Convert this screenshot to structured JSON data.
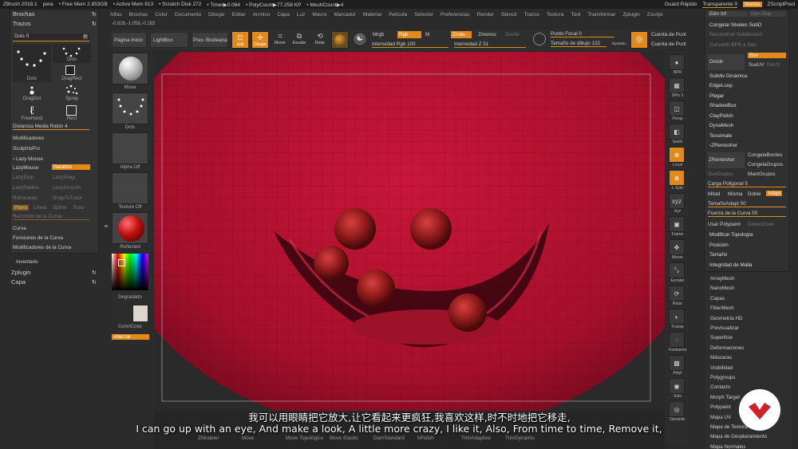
{
  "titlebar": {
    "app": "ZBrush 2018.1",
    "doc": "pera",
    "stats": [
      "• Free Mem 2.853GB",
      "• Active Mem 813",
      "• Scratch Disk 272",
      "• Timer▶0.064",
      "• PolyCount▶77.258 KP",
      "• MeshCount▶4"
    ],
    "quicksave": "Guard Rápido",
    "transparent": "Transparente 0",
    "menus_btn": "Menús",
    "script": "ZScriptPred"
  },
  "menubar": [
    "Alfas",
    "Brochas",
    "Color",
    "Documento",
    "Dibujar",
    "Editar",
    "Archivo",
    "Capa",
    "Luz",
    "Macro",
    "Marcador",
    "Material",
    "Película",
    "Selector",
    "Preferencias",
    "Render",
    "Stencil",
    "Trazos",
    "Textura",
    "Tool",
    "Transformar",
    "Zplugin",
    "Zscript"
  ],
  "coords": "-0.826,-1.058,-0.183",
  "toolbar": {
    "home": "Página Inicio",
    "lightbox": "LightBox",
    "preview": "Prev. Booleana",
    "edit": "Edit",
    "draw": "Dibujar",
    "move": "Mover",
    "scale": "Escalar",
    "rotate": "Rotar",
    "mrgb": "Mrgb",
    "rgb": "Rgb",
    "m": "M",
    "zadd": "Zmás",
    "zsub": "Zmenos",
    "zcut": "Zcorte",
    "rgb_intensity": "Intensidad Rgb 100",
    "z_intensity": "Intensidad Z 51",
    "focal": "Punto Focal 0",
    "draw_size": "Tamaño de dibujo 132",
    "dynamic": "Dynamic",
    "cuenta1": "Cuenta de Punt",
    "cuenta2": "Cuenta de Punt"
  },
  "left_panel": {
    "brushes_header": "Brochas",
    "strokes_header": "Trazos",
    "dots": "Dots 0",
    "r": "R",
    "stroke_types": [
      "Dots",
      "Dots",
      "DragDot",
      "DragRect",
      "FreeHand",
      "Spray",
      "Rect"
    ],
    "mouse_avg": "Distancia Media Ratón 4",
    "modifiers": "Modificadores",
    "sculptris": "SculptrisPro",
    "lazy_mouse": "Lazy Mouse",
    "lazymouse": "LazyMouse",
    "relative": "Relativo",
    "lazystep": "LazyStep",
    "lazysnap": "LazySnap",
    "lazyradius": "LazyRadius",
    "lazysmooth": "LazySmooth",
    "backtrack": "Retroceder",
    "snaptotrack": "SnapToTrack",
    "plane": "Plano",
    "line": "Línea",
    "spline": "Spline",
    "path": "Ruta",
    "curve_step": "Recorrido de la Curva",
    "curve": "Curva",
    "curve_funcs": "Funciones de la Curva",
    "curve_mods": "Modificadores de la Curva",
    "inventory": "Inventario",
    "zplugin": "Zplugin",
    "layer": "Capa"
  },
  "shelf": {
    "move": "Move",
    "dots": "Dots",
    "alpha": "Alpha Off",
    "texture": "Texture Off",
    "material": "Reflected",
    "gradient": "Degradado",
    "switchcolor": "ConmColor",
    "alternate": "Alternar"
  },
  "right_tools": [
    "BPR",
    "SPix 3",
    "Persp",
    "Suelo",
    "Local",
    "L.Sym",
    "Xyz",
    "Frame",
    "Mover",
    "Escalar",
    "Rotar",
    "Transp",
    "Fantasma",
    "Polyf",
    "Solo",
    "Dynamic"
  ],
  "right_menu": {
    "elim_inf": "Elim Inf",
    "elim_sup": "Elim Sup",
    "freeze": "Congelar Niveles SubD",
    "rebuild": "Reconstruir Subdivisión",
    "convert": "Convertir BPR a Geo",
    "divide": "Dividir",
    "smt": "Suv",
    "suv": "SuvUV",
    "reuv": "ReUV",
    "dynamic_subdiv": "Subdiv Dinámica",
    "edgeloop": "EdgeLoop",
    "fold": "Plegar",
    "shadowbox": "ShadowBox",
    "claypolish": "ClayPolish",
    "dynamesh": "DynaMesh",
    "tessimate": "Tessimate",
    "zremesher_header": "ZRemesher",
    "zremesher": "ZRemesher",
    "freeze_borders": "CongelaBordes",
    "freeze_groups": "CongelaGrupos",
    "smoothgroups": "SuvGrupos",
    "keep_groups": "MantGrupos",
    "poly_load": "Carga Poligonal 5",
    "half": "Mitad",
    "same": "Misma",
    "double": "Doble",
    "adapt": "Adapt",
    "adapt_size": "TamañoAdapt 50",
    "curve_strength": "Fuerza de la Curva 50",
    "use_polypaint": "Usar Polypaint",
    "detect_color": "DetectColor",
    "modify_topology": "Modificar Topología",
    "position": "Posición",
    "size": "Tamaño",
    "mesh_integrity": "Integridad de Malla",
    "list": [
      "ArrayMesh",
      "NanoMesh",
      "Capas",
      "FiberMesh",
      "Geometría HD",
      "Previsualizar",
      "Superficie",
      "Deformaciones",
      "Máscaras",
      "Visibilidad",
      "Polygroups",
      "Contacto",
      "Morph Target",
      "Polypaint",
      "Mapa UV",
      "Mapa de Textura",
      "Mapa de Desplazamiento",
      "Mapa Normales"
    ]
  },
  "bottom": {
    "brushes": [
      "ZModeler",
      "Move",
      "Move Topológico",
      "Move Elastic",
      "DamStandard",
      "hPolish",
      "TrimAdaptive",
      "TrimDynamic"
    ]
  },
  "subtitles": {
    "zh": "我可以用眼睛把它放大,让它看起来更疯狂,我喜欢这样,时不时地把它移走,",
    "en": "I can go up with an eye, And make a look, A little more crazy, I like it, Also, From time to time, Remove it,"
  },
  "colors": {
    "accent": "#e3891c",
    "sculpt": "#b0102c",
    "bg": "#2b2b2b",
    "logo": "#d0202a"
  }
}
